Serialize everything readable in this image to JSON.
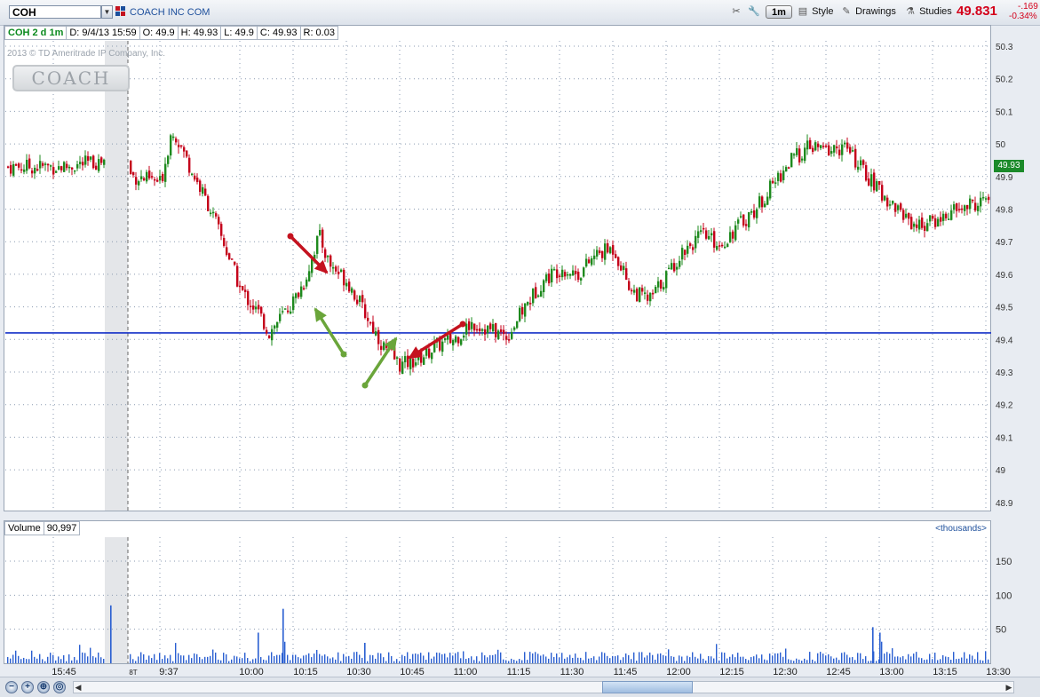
{
  "toolbar": {
    "symbol": "COH",
    "company": "COACH INC COM",
    "aggregation": "1m",
    "style_label": "Style",
    "drawings_label": "Drawings",
    "studies_label": "Studies",
    "last_price": "49.831",
    "change": "-.169",
    "change_pct": "-0.34%"
  },
  "info": {
    "tag": "COH 2 d 1m",
    "date": "D: 9/4/13 15:59",
    "open": "O: 49.9",
    "high": "H: 49.93",
    "low": "L: 49.9",
    "close": "C: 49.93",
    "range": "R: 0.03"
  },
  "watermark": "2013 © TD Ameritrade IP Company, Inc.",
  "logo_text": "COACH",
  "last_label": "49.93",
  "volume": {
    "label": "Volume",
    "value": "90,997",
    "units": "<thousands>"
  },
  "colors": {
    "up": "#1e8a1e",
    "down": "#c4001a",
    "support": "#1530c8",
    "grid": "#8a9ab0",
    "green_arrow": "#6aa53a",
    "red_arrow": "#c4121f"
  },
  "chart_data": {
    "type": "candlestick",
    "symbol": "COH",
    "interval": "1m",
    "ylim": [
      48.85,
      50.35
    ],
    "y_ticks": [
      48.9,
      49,
      49.1,
      49.2,
      49.3,
      49.4,
      49.5,
      49.6,
      49.7,
      49.8,
      49.9,
      50,
      50.1,
      50.2,
      50.3
    ],
    "x_ticks": [
      "15:45",
      "8T",
      "9:37",
      "10:00",
      "10:15",
      "10:30",
      "10:45",
      "11:00",
      "11:15",
      "11:30",
      "11:45",
      "12:00",
      "12:15",
      "12:30",
      "12:45",
      "13:00",
      "13:15",
      "13:30"
    ],
    "volume_ticks": [
      50,
      100,
      150
    ],
    "volume_ylim": [
      0,
      175
    ],
    "support_line": 49.42,
    "price_path": [
      [
        "15:45",
        49.93
      ],
      [
        "15:59",
        49.95
      ],
      [
        "9:30",
        49.9
      ],
      [
        "9:37",
        49.88
      ],
      [
        "9:40",
        50.05
      ],
      [
        "9:45",
        49.92
      ],
      [
        "9:50",
        49.8
      ],
      [
        "9:55",
        49.65
      ],
      [
        "10:00",
        49.55
      ],
      [
        "10:05",
        49.48
      ],
      [
        "10:08",
        49.42
      ],
      [
        "10:10",
        49.45
      ],
      [
        "10:15",
        49.52
      ],
      [
        "10:18",
        49.58
      ],
      [
        "10:22",
        49.72
      ],
      [
        "10:25",
        49.63
      ],
      [
        "10:30",
        49.58
      ],
      [
        "10:35",
        49.48
      ],
      [
        "10:40",
        49.38
      ],
      [
        "10:45",
        49.32
      ],
      [
        "10:50",
        49.34
      ],
      [
        "10:55",
        49.38
      ],
      [
        "11:00",
        49.4
      ],
      [
        "11:05",
        49.45
      ],
      [
        "11:10",
        49.43
      ],
      [
        "11:15",
        49.41
      ],
      [
        "11:20",
        49.5
      ],
      [
        "11:25",
        49.58
      ],
      [
        "11:30",
        49.62
      ],
      [
        "11:35",
        49.6
      ],
      [
        "11:40",
        49.66
      ],
      [
        "11:45",
        49.68
      ],
      [
        "11:50",
        49.55
      ],
      [
        "11:55",
        49.52
      ],
      [
        "12:00",
        49.6
      ],
      [
        "12:05",
        49.68
      ],
      [
        "12:10",
        49.72
      ],
      [
        "12:15",
        49.69
      ],
      [
        "12:20",
        49.75
      ],
      [
        "12:25",
        49.8
      ],
      [
        "12:30",
        49.88
      ],
      [
        "12:35",
        49.95
      ],
      [
        "12:40",
        49.99
      ],
      [
        "12:45",
        49.98
      ],
      [
        "12:50",
        49.99
      ],
      [
        "12:55",
        49.92
      ],
      [
        "13:00",
        49.85
      ],
      [
        "13:05",
        49.8
      ],
      [
        "13:10",
        49.75
      ],
      [
        "13:15",
        49.76
      ],
      [
        "13:20",
        49.79
      ],
      [
        "13:25",
        49.81
      ],
      [
        "13:30",
        49.83
      ]
    ],
    "volume_spikes": [
      [
        "8T",
        85
      ],
      [
        "10:12",
        80
      ],
      [
        "10:05",
        45
      ],
      [
        "12:58",
        53
      ],
      [
        "13:00",
        45
      ],
      [
        "10:35",
        30
      ]
    ]
  }
}
